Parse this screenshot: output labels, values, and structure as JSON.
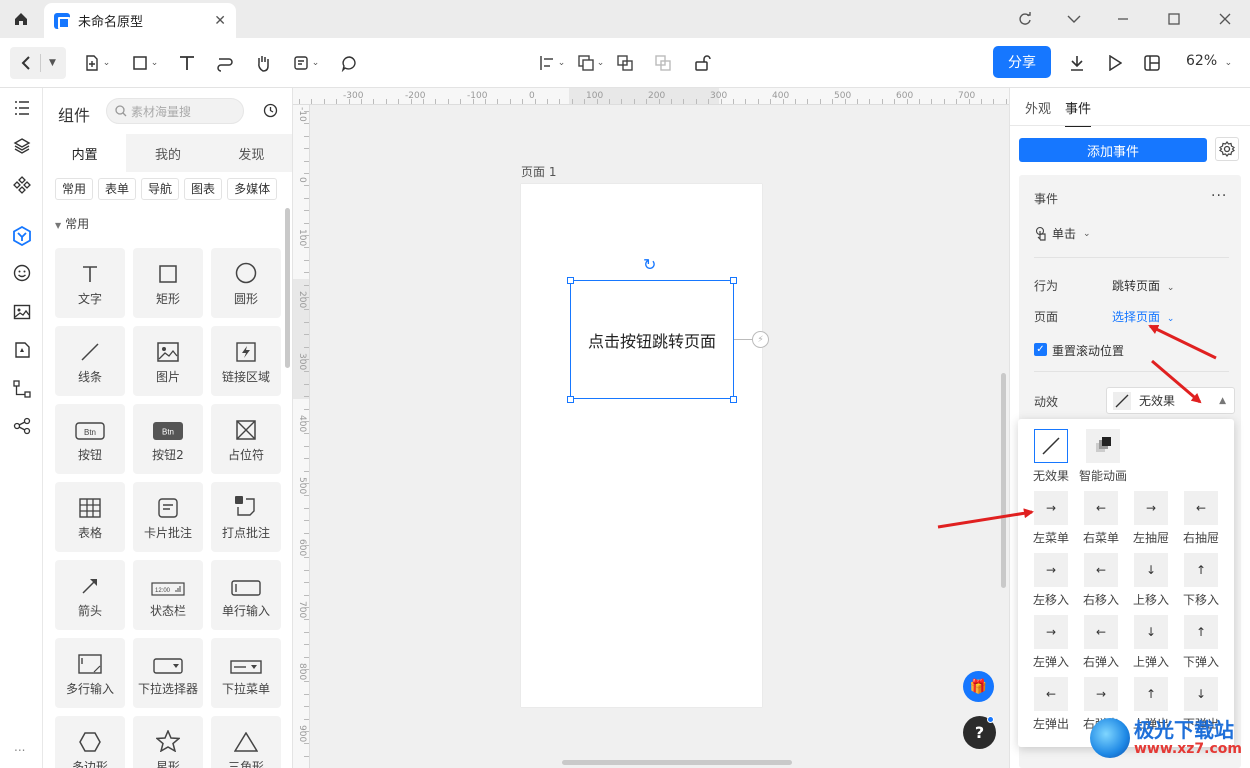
{
  "window": {
    "tab_title": "未命名原型",
    "controls": [
      "refresh-icon",
      "chevron-down-icon",
      "minimize-icon",
      "maximize-icon",
      "close-icon"
    ]
  },
  "toolbar": {
    "share_label": "分享",
    "zoom": "62%",
    "tools": [
      "back-icon",
      "add-page-icon",
      "rectangle-icon",
      "text-icon",
      "connector-icon",
      "hand-icon",
      "note-icon",
      "comment-icon",
      "align-icon",
      "arrange-icon",
      "group-icon",
      "ungroup-icon",
      "unlock-icon",
      "download-icon",
      "play-icon",
      "layout-icon"
    ]
  },
  "rail": {
    "items": [
      "outline-icon",
      "layers-icon",
      "components-icon",
      "widgets-icon",
      "emoji-icon",
      "image-icon",
      "brand-icon",
      "flow-icon",
      "share-node-icon"
    ],
    "more": "..."
  },
  "components_panel": {
    "title": "组件",
    "search_placeholder": "素材海量搜",
    "tabs": [
      "内置",
      "我的",
      "发现"
    ],
    "chips": [
      "常用",
      "表单",
      "导航",
      "图表",
      "多媒体"
    ],
    "section": "常用",
    "items": [
      {
        "label": "文字",
        "icon": "text-icon"
      },
      {
        "label": "矩形",
        "icon": "rectangle-icon"
      },
      {
        "label": "圆形",
        "icon": "circle-icon"
      },
      {
        "label": "线条",
        "icon": "line-icon"
      },
      {
        "label": "图片",
        "icon": "image-icon"
      },
      {
        "label": "链接区域",
        "icon": "link-area-icon"
      },
      {
        "label": "按钮",
        "icon": "button-icon"
      },
      {
        "label": "按钮2",
        "icon": "button2-icon"
      },
      {
        "label": "占位符",
        "icon": "placeholder-icon"
      },
      {
        "label": "表格",
        "icon": "table-icon"
      },
      {
        "label": "卡片批注",
        "icon": "card-note-icon"
      },
      {
        "label": "打点批注",
        "icon": "dot-note-icon"
      },
      {
        "label": "箭头",
        "icon": "arrow-icon"
      },
      {
        "label": "状态栏",
        "icon": "status-bar-icon"
      },
      {
        "label": "单行输入",
        "icon": "single-input-icon"
      },
      {
        "label": "多行输入",
        "icon": "multi-input-icon"
      },
      {
        "label": "下拉选择器",
        "icon": "dropdown-picker-icon"
      },
      {
        "label": "下拉菜单",
        "icon": "dropdown-menu-icon"
      },
      {
        "label": "多边形",
        "icon": "polygon-icon"
      },
      {
        "label": "星形",
        "icon": "star-icon"
      },
      {
        "label": "三角形",
        "icon": "triangle-icon"
      }
    ],
    "btn_text": "Btn",
    "status_text": "12:00"
  },
  "ruler": {
    "h": [
      "-300",
      "-200",
      "-100",
      "0",
      "100",
      "200",
      "300",
      "400",
      "500",
      "600",
      "700"
    ],
    "v": [
      "-10",
      "0",
      "100",
      "200",
      "300",
      "400",
      "500",
      "600",
      "700",
      "800",
      "900"
    ]
  },
  "canvas": {
    "page_label": "页面 1",
    "button_text": "点击按钮跳转页面"
  },
  "right_panel": {
    "tabs": [
      "外观",
      "事件"
    ],
    "add_event_label": "添加事件",
    "event_title": "事件",
    "more": "...",
    "trigger": "单击",
    "action_label": "行为",
    "action_value": "跳转页面",
    "page_label": "页面",
    "page_value": "选择页面",
    "reset_scroll_label": "重置滚动位置",
    "reset_scroll_checked": true,
    "animation_label": "动效",
    "animation_value": "无效果"
  },
  "animation_options": {
    "top": [
      {
        "label": "无效果",
        "icon": "no-effect-icon",
        "selected": true
      },
      {
        "label": "智能动画",
        "icon": "smart-animate-icon",
        "selected": false
      }
    ],
    "grid": [
      {
        "label": "左菜单",
        "glyph": "→"
      },
      {
        "label": "右菜单",
        "glyph": "←"
      },
      {
        "label": "左抽屉",
        "glyph": "→"
      },
      {
        "label": "右抽屉",
        "glyph": "←"
      },
      {
        "label": "左移入",
        "glyph": "→"
      },
      {
        "label": "右移入",
        "glyph": "←"
      },
      {
        "label": "上移入",
        "glyph": "↓"
      },
      {
        "label": "下移入",
        "glyph": "↑"
      },
      {
        "label": "左弹入",
        "glyph": "→"
      },
      {
        "label": "右弹入",
        "glyph": "←"
      },
      {
        "label": "上弹入",
        "glyph": "↓"
      },
      {
        "label": "下弹入",
        "glyph": "↑"
      },
      {
        "label": "左弹出",
        "glyph": "←"
      },
      {
        "label": "右弹出",
        "glyph": "→"
      },
      {
        "label": "上弹出",
        "glyph": "↑"
      },
      {
        "label": "下弹出",
        "glyph": "↓"
      }
    ]
  },
  "watermark": {
    "name": "极光下载站",
    "url": "www.xz7.com"
  },
  "colors": {
    "accent": "#1677ff",
    "annotation": "#e02020"
  }
}
